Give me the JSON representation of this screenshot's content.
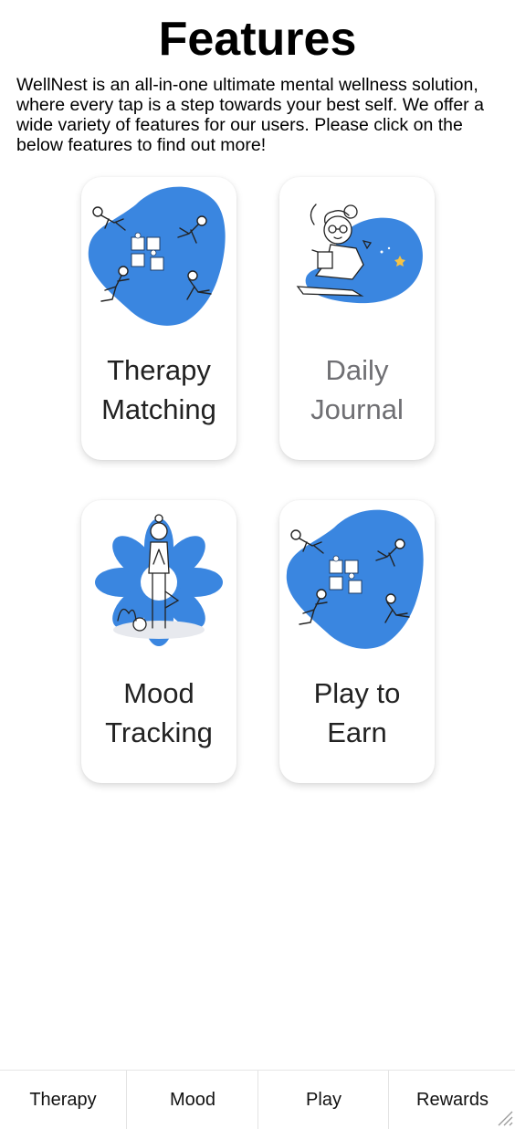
{
  "page": {
    "title": "Features",
    "intro": "WellNest is an all-in-one ultimate mental wellness solution, where every tap is a step towards your best self. We offer a wide variety of features for our users. Please click on the below features to find out more!"
  },
  "features": [
    {
      "line1": "Therapy",
      "line2": "Matching",
      "illustration": "puzzle-teamwork-illustration"
    },
    {
      "line1": "Daily",
      "line2": "Journal",
      "illustration": "journaling-woman-illustration"
    },
    {
      "line1": "Mood",
      "line2": "Tracking",
      "illustration": "yoga-tree-pose-illustration"
    },
    {
      "line1": "Play to",
      "line2": "Earn",
      "illustration": "puzzle-teamwork-illustration"
    }
  ],
  "tabs": [
    {
      "label": "Therapy"
    },
    {
      "label": "Mood"
    },
    {
      "label": "Play"
    },
    {
      "label": "Rewards"
    }
  ],
  "colors": {
    "accent": "#3a86e0",
    "text": "#222222",
    "muted_text": "#6f6f73"
  }
}
